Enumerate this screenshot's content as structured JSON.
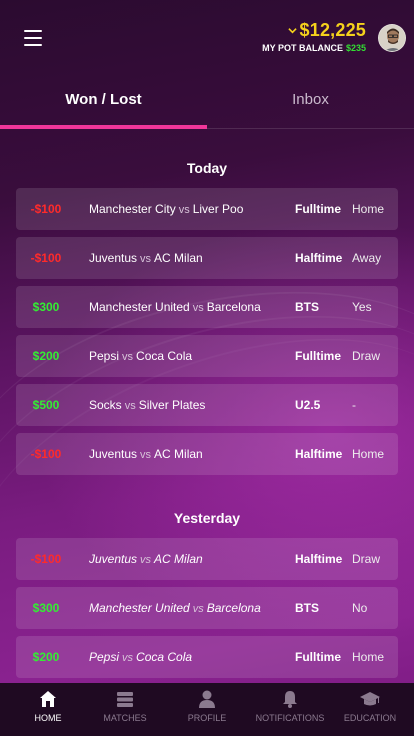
{
  "header": {
    "balance": "$12,225",
    "pot_label": "MY POT BALANCE",
    "pot_value": "$235"
  },
  "tabs": [
    {
      "label": "Won / Lost",
      "active": true
    },
    {
      "label": "Inbox",
      "active": false
    }
  ],
  "sections": {
    "today": "Today",
    "yesterday": "Yesterday"
  },
  "today_bets": [
    {
      "amount": "-$100",
      "home": "Manchester City",
      "vs": "vs",
      "away": "Liver Poo",
      "type": "Fulltime",
      "pick": "Home"
    },
    {
      "amount": "-$100",
      "home": "Juventus",
      "vs": "vs",
      "away": "AC Milan",
      "type": "Halftime",
      "pick": "Away"
    },
    {
      "amount": "$300",
      "home": "Manchester United",
      "vs": "vs",
      "away": "Barcelona",
      "type": "BTS",
      "pick": "Yes"
    },
    {
      "amount": "$200",
      "home": "Pepsi",
      "vs": "vs",
      "away": "Coca Cola",
      "type": "Fulltime",
      "pick": "Draw"
    },
    {
      "amount": "$500",
      "home": "Socks",
      "vs": "vs",
      "away": "Silver Plates",
      "type": "U2.5",
      "pick": "-"
    },
    {
      "amount": "-$100",
      "home": "Juventus",
      "vs": "vs",
      "away": "AC Milan",
      "type": "Halftime",
      "pick": "Home"
    }
  ],
  "yesterday_bets": [
    {
      "amount": "-$100",
      "home": "Juventus",
      "vs": "vs",
      "away": "AC Milan",
      "type": "Halftime",
      "pick": "Draw"
    },
    {
      "amount": "$300",
      "home": "Manchester United",
      "vs": "vs",
      "away": "Barcelona",
      "type": "BTS",
      "pick": "No"
    },
    {
      "amount": "$200",
      "home": "Pepsi",
      "vs": "vs",
      "away": "Coca Cola",
      "type": "Fulltime",
      "pick": "Home"
    }
  ],
  "nav": [
    {
      "label": "HOME",
      "icon": "home-icon",
      "active": true
    },
    {
      "label": "MATCHES",
      "icon": "matches-icon",
      "active": false
    },
    {
      "label": "PROFILE",
      "icon": "profile-icon",
      "active": false
    },
    {
      "label": "NOTIFICATIONS",
      "icon": "bell-icon",
      "active": false
    },
    {
      "label": "EDUCATION",
      "icon": "graduation-cap-icon",
      "active": false
    }
  ],
  "colors": {
    "accent": "#f0369a",
    "balance": "#f5d21c",
    "win": "#33ee33",
    "loss": "#ff2a2a"
  }
}
